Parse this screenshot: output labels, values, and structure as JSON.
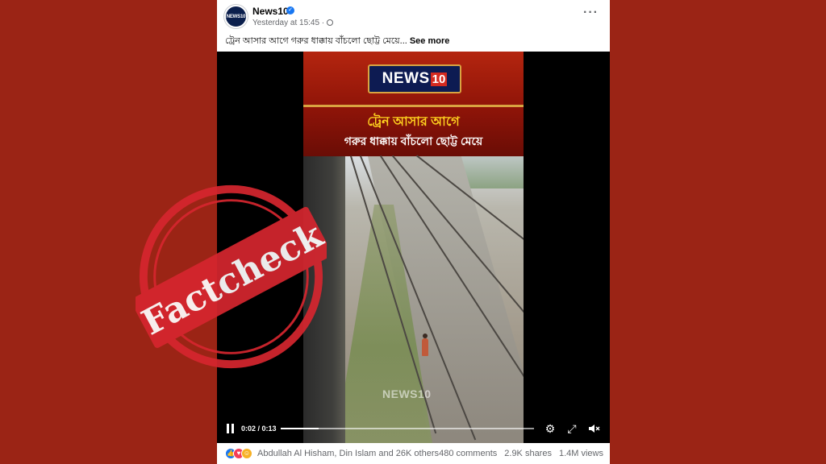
{
  "post": {
    "page_name": "News10",
    "timestamp": "Yesterday at 15:45",
    "avatar_text": "NEWS10",
    "more_icon": "more-horizontal-icon",
    "caption": "ট্রেন আসার আগে গরুর ধাক্কায় বাঁচলো ছোট্ট মেয়ে...",
    "see_more": "See more"
  },
  "video": {
    "logo": {
      "text": "NEWS",
      "number": "10"
    },
    "headline_line1": "ট্রেন আসার আগে",
    "headline_line2": "গরুর ধাক্কায় বাঁচলো ছোট্ট মেয়ে",
    "watermark": "NEWS10",
    "current_time": "0:02",
    "duration": "0:13",
    "time_display": "0:02 / 0:13",
    "progress": 0.15,
    "controls": {
      "pause": "pause-icon",
      "settings": "gear-icon",
      "fullscreen": "fullscreen-icon",
      "volume": "volume-muted-icon"
    }
  },
  "footer": {
    "reactions": [
      "like",
      "love",
      "care"
    ],
    "reaction_names": "Abdullah Al Hisham, Din Islam and 26K others",
    "comments": "480 comments",
    "shares": "2.9K shares",
    "views": "1.4M views"
  },
  "stamp": {
    "text": "Factcheck",
    "color": "#d6262f"
  },
  "colors": {
    "background": "#9b2415",
    "facebook_blue": "#1877f2"
  }
}
